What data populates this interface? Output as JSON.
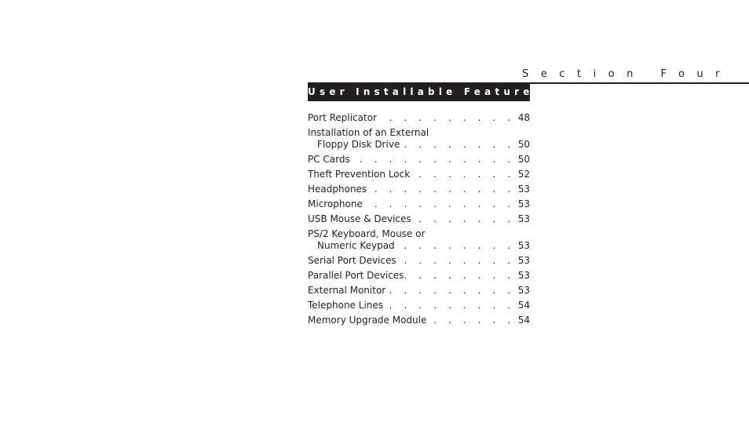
{
  "section_label": "Section Four",
  "header": {
    "title": "User Installable Features"
  },
  "leader": ". . . . . . . . . . . . . . . . . . . . . . . . . . . . . .",
  "toc": [
    {
      "lines": [
        "Port Replicator"
      ],
      "page": "48"
    },
    {
      "lines": [
        "Installation of an External",
        "Floppy Disk Drive"
      ],
      "page": "50"
    },
    {
      "lines": [
        "PC Cards"
      ],
      "page": "50"
    },
    {
      "lines": [
        "Theft Prevention Lock"
      ],
      "page": "52"
    },
    {
      "lines": [
        "Headphones"
      ],
      "page": "53"
    },
    {
      "lines": [
        "Microphone"
      ],
      "page": "53"
    },
    {
      "lines": [
        "USB Mouse & Devices"
      ],
      "page": "53"
    },
    {
      "lines": [
        "PS/2 Keyboard, Mouse or",
        "Numeric Keypad"
      ],
      "page": "53"
    },
    {
      "lines": [
        "Serial Port Devices"
      ],
      "page": "53"
    },
    {
      "lines": [
        "Parallel Port Devices"
      ],
      "page": "53"
    },
    {
      "lines": [
        "External Monitor"
      ],
      "page": "53"
    },
    {
      "lines": [
        "Telephone Lines"
      ],
      "page": "54"
    },
    {
      "lines": [
        "Memory Upgrade Module"
      ],
      "page": "54"
    }
  ]
}
